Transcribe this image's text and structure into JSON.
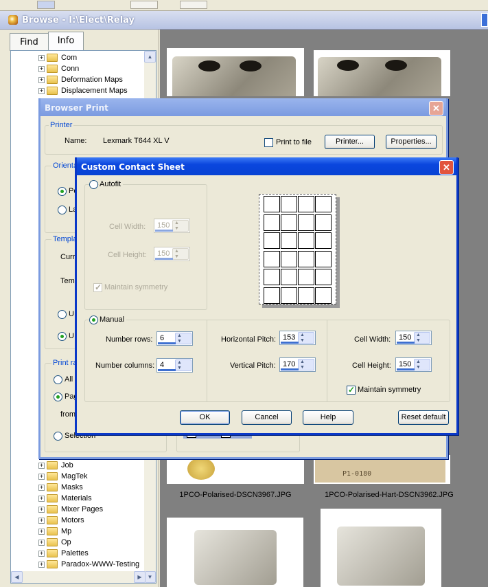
{
  "window": {
    "title": "Browse - I:\\Elect\\Relay"
  },
  "tabs": {
    "find": "Find",
    "info": "Info"
  },
  "tree": {
    "top_items": [
      "Com",
      "Conn",
      "Deformation Maps",
      "Displacement Maps"
    ],
    "bottom_items": [
      "Job",
      "MagTek",
      "Masks",
      "Materials",
      "Mixer Pages",
      "Motors",
      "Mp",
      "Op",
      "Palettes",
      "Paradox-WWW-Testing"
    ]
  },
  "thumbnails": {
    "captions": [
      "1PCO-Polarised-DSCN3967.JPG",
      "1PCO-Polarised-Hart-DSCN3962.JPG"
    ],
    "label_text": "P1-0180"
  },
  "browser_print": {
    "title": "Browser Print",
    "printer_group": "Printer",
    "name_label": "Name:",
    "name_value": "Lexmark T644 XL V",
    "print_to_file": "Print to file",
    "printer_button": "Printer...",
    "properties_button": "Properties...",
    "orientation_group": "Orienta",
    "portrait": "Po",
    "landscape": "La",
    "template_group": "Templa",
    "current": "Curre",
    "template": "Temp",
    "use1": "U",
    "use2": "U",
    "print_range_group": "Print ra",
    "all": "All",
    "pages": "Pag",
    "from": "from:",
    "selection": "Selection"
  },
  "contact_sheet": {
    "title": "Custom Contact Sheet",
    "autofit": "Autofit",
    "cell_width_label": "Cell Width:",
    "cell_width_value": "150",
    "cell_height_label": "Cell Height:",
    "cell_height_value": "150",
    "maintain_symmetry": "Maintain symmetry",
    "manual": "Manual",
    "number_rows_label": "Number rows:",
    "number_rows_value": "6",
    "number_columns_label": "Number columns:",
    "number_columns_value": "4",
    "horizontal_pitch_label": "Horizontal Pitch:",
    "horizontal_pitch_value": "153",
    "vertical_pitch_label": "Vertical Pitch:",
    "vertical_pitch_value": "170",
    "manual_cell_width_label": "Cell Width:",
    "manual_cell_width_value": "150",
    "manual_cell_height_label": "Cell Height:",
    "manual_cell_height_value": "150",
    "manual_maintain_symmetry": "Maintain symmetry",
    "ok": "OK",
    "cancel": "Cancel",
    "help": "Help",
    "reset_default": "Reset default",
    "preview_rows": 6,
    "preview_cols": 4
  }
}
